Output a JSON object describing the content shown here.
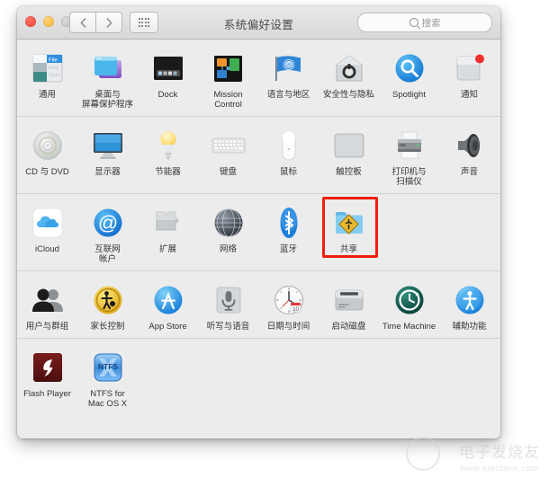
{
  "window": {
    "title": "系统偏好设置",
    "traffic_lights": [
      "close-red",
      "minimize-yellow",
      "zoom-gray"
    ],
    "nav": {
      "back": "‹",
      "forward": "›"
    },
    "grid_button": "show-all-grid",
    "search": {
      "placeholder": "搜索",
      "value": ""
    }
  },
  "highlight": {
    "target": "共享",
    "color": "#f21d0d"
  },
  "watermark": {
    "text": "电子发烧友",
    "url": "www.elecfans.com"
  },
  "rows": [
    {
      "items": [
        {
          "label": "通用",
          "icon": "general-icon"
        },
        {
          "label": "桌面与\n屏幕保护程序",
          "icon": "desktop-screensaver-icon"
        },
        {
          "label": "Dock",
          "icon": "dock-icon"
        },
        {
          "label": "Mission\nControl",
          "icon": "mission-control-icon"
        },
        {
          "label": "语言与地区",
          "icon": "language-region-icon"
        },
        {
          "label": "安全性与隐私",
          "icon": "security-privacy-icon"
        },
        {
          "label": "Spotlight",
          "icon": "spotlight-icon"
        },
        {
          "label": "通知",
          "icon": "notifications-icon"
        }
      ]
    },
    {
      "items": [
        {
          "label": "CD 与 DVD",
          "icon": "cd-dvd-icon"
        },
        {
          "label": "显示器",
          "icon": "displays-icon"
        },
        {
          "label": "节能器",
          "icon": "energy-saver-icon"
        },
        {
          "label": "键盘",
          "icon": "keyboard-icon"
        },
        {
          "label": "鼠标",
          "icon": "mouse-icon"
        },
        {
          "label": "触控板",
          "icon": "trackpad-icon"
        },
        {
          "label": "打印机与\n扫描仪",
          "icon": "printers-scanners-icon"
        },
        {
          "label": "声音",
          "icon": "sound-icon"
        }
      ]
    },
    {
      "items": [
        {
          "label": "iCloud",
          "icon": "icloud-icon"
        },
        {
          "label": "互联网\n帐户",
          "icon": "internet-accounts-icon"
        },
        {
          "label": "扩展",
          "icon": "extensions-icon"
        },
        {
          "label": "网络",
          "icon": "network-icon"
        },
        {
          "label": "蓝牙",
          "icon": "bluetooth-icon"
        },
        {
          "label": "共享",
          "icon": "sharing-icon"
        }
      ]
    },
    {
      "items": [
        {
          "label": "用户与群组",
          "icon": "users-groups-icon"
        },
        {
          "label": "家长控制",
          "icon": "parental-controls-icon"
        },
        {
          "label": "App Store",
          "icon": "app-store-icon"
        },
        {
          "label": "听写与语音",
          "icon": "dictation-speech-icon"
        },
        {
          "label": "日期与时间",
          "icon": "date-time-icon"
        },
        {
          "label": "启动磁盘",
          "icon": "startup-disk-icon"
        },
        {
          "label": "Time Machine",
          "icon": "time-machine-icon"
        },
        {
          "label": "辅助功能",
          "icon": "accessibility-icon"
        }
      ]
    },
    {
      "items": [
        {
          "label": "Flash Player",
          "icon": "flash-player-icon"
        },
        {
          "label": "NTFS for\nMac OS X",
          "icon": "ntfs-for-mac-icon"
        }
      ]
    }
  ]
}
